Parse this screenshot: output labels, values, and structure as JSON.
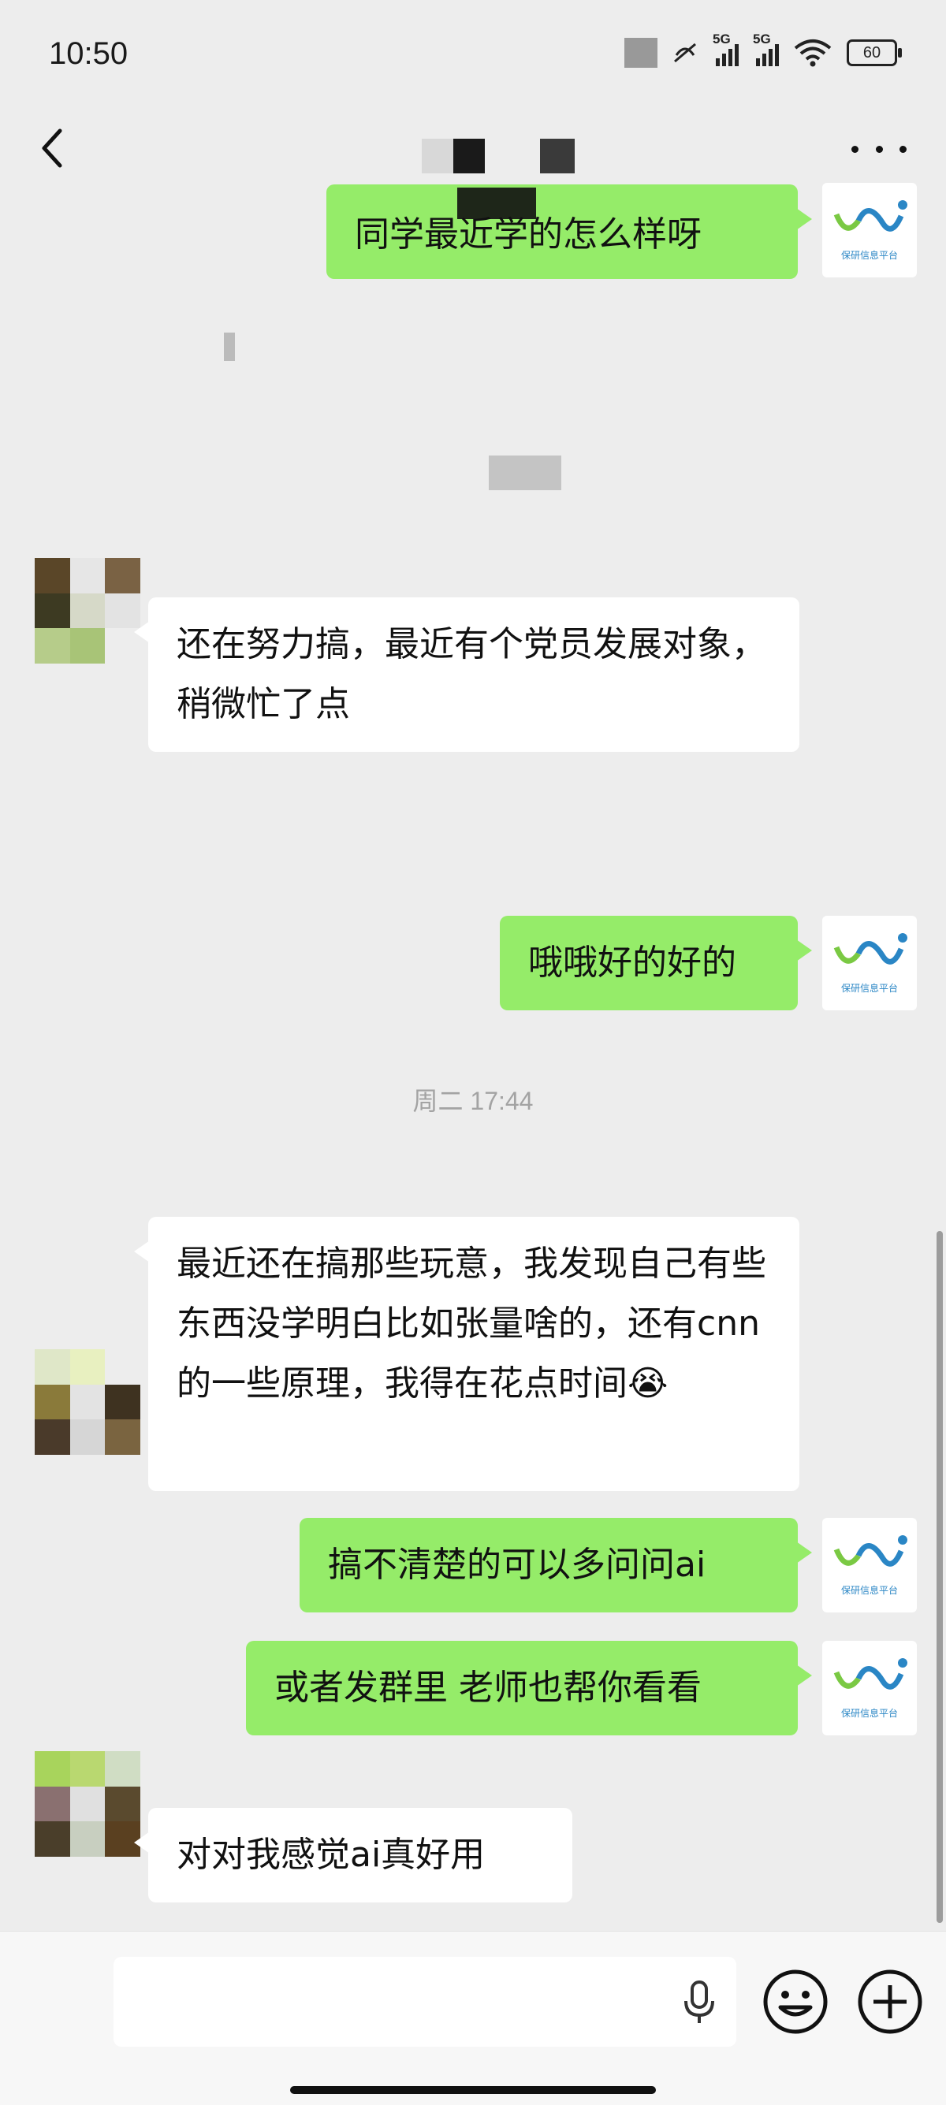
{
  "status_bar": {
    "time": "10:50",
    "network_1": "5G",
    "network_2": "5G",
    "battery": "60"
  },
  "header": {
    "back_icon": "chevron-left-icon",
    "more_icon": "more-horizontal-icon"
  },
  "messages": [
    {
      "side": "right",
      "text": "同学最近学的怎么样呀"
    },
    {
      "side": "left",
      "text": "还在努力搞，最近有个党员发展对象，稍微忙了点"
    },
    {
      "side": "right",
      "text": "哦哦好的好的"
    },
    {
      "side": "left",
      "text": "最近还在搞那些玩意，我发现自己有些东西没学明白比如张量啥的，还有cnn的一些原理，我得在花点时间😭"
    },
    {
      "side": "right",
      "text": "搞不清楚的可以多问问ai"
    },
    {
      "side": "right",
      "text": "或者发群里 老师也帮你看看"
    },
    {
      "side": "left",
      "text": "对对我感觉ai真好用"
    }
  ],
  "timestamp": "周二 17:44",
  "self_avatar_caption": "保研信息平台",
  "input": {
    "value": "",
    "mic_icon": "microphone-icon",
    "emoji_icon": "emoji-icon",
    "plus_icon": "plus-circle-icon"
  },
  "colors": {
    "background": "#ededed",
    "outgoing_bubble": "#95ec69",
    "incoming_bubble": "#ffffff"
  }
}
